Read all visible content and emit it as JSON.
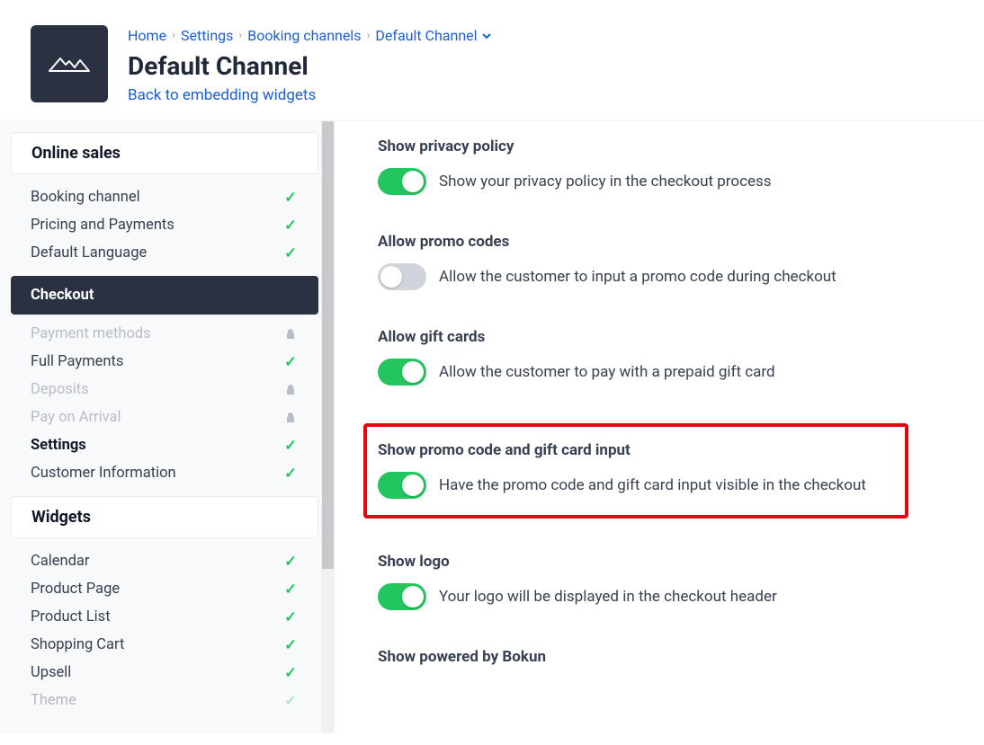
{
  "breadcrumb": {
    "home": "Home",
    "settings": "Settings",
    "booking_channels": "Booking channels",
    "current": "Default Channel"
  },
  "page_title": "Default Channel",
  "back_link": "Back to embedding widgets",
  "sidebar": {
    "groups": [
      {
        "title": "Online sales",
        "items": [
          {
            "label": "Booking channel",
            "state": "completed"
          },
          {
            "label": "Pricing and Payments",
            "state": "completed"
          },
          {
            "label": "Default Language",
            "state": "completed"
          }
        ]
      },
      {
        "title": "Checkout",
        "active": true,
        "items": [
          {
            "label": "Payment methods",
            "state": "locked"
          },
          {
            "label": "Full Payments",
            "state": "completed"
          },
          {
            "label": "Deposits",
            "state": "locked"
          },
          {
            "label": "Pay on Arrival",
            "state": "locked"
          },
          {
            "label": "Settings",
            "state": "completed",
            "bold": true
          },
          {
            "label": "Customer Information",
            "state": "completed"
          }
        ]
      },
      {
        "title": "Widgets",
        "items": [
          {
            "label": "Calendar",
            "state": "completed"
          },
          {
            "label": "Product Page",
            "state": "completed"
          },
          {
            "label": "Product List",
            "state": "completed"
          },
          {
            "label": "Shopping Cart",
            "state": "completed"
          },
          {
            "label": "Upsell",
            "state": "completed"
          },
          {
            "label": "Theme",
            "state": "completed"
          }
        ]
      }
    ]
  },
  "settings": {
    "privacy": {
      "title": "Show privacy policy",
      "desc": "Show your privacy policy in the checkout process",
      "on": true
    },
    "promo": {
      "title": "Allow promo codes",
      "desc": "Allow the customer to input a promo code during checkout",
      "on": false
    },
    "gift": {
      "title": "Allow gift cards",
      "desc": "Allow the customer to pay with a prepaid gift card",
      "on": true
    },
    "promo_gift_input": {
      "title": "Show promo code and gift card input",
      "desc": "Have the promo code and gift card input visible in the checkout",
      "on": true
    },
    "logo": {
      "title": "Show logo",
      "desc": "Your logo will be displayed in the checkout header",
      "on": true
    },
    "powered": {
      "title": "Show powered by Bokun"
    }
  }
}
